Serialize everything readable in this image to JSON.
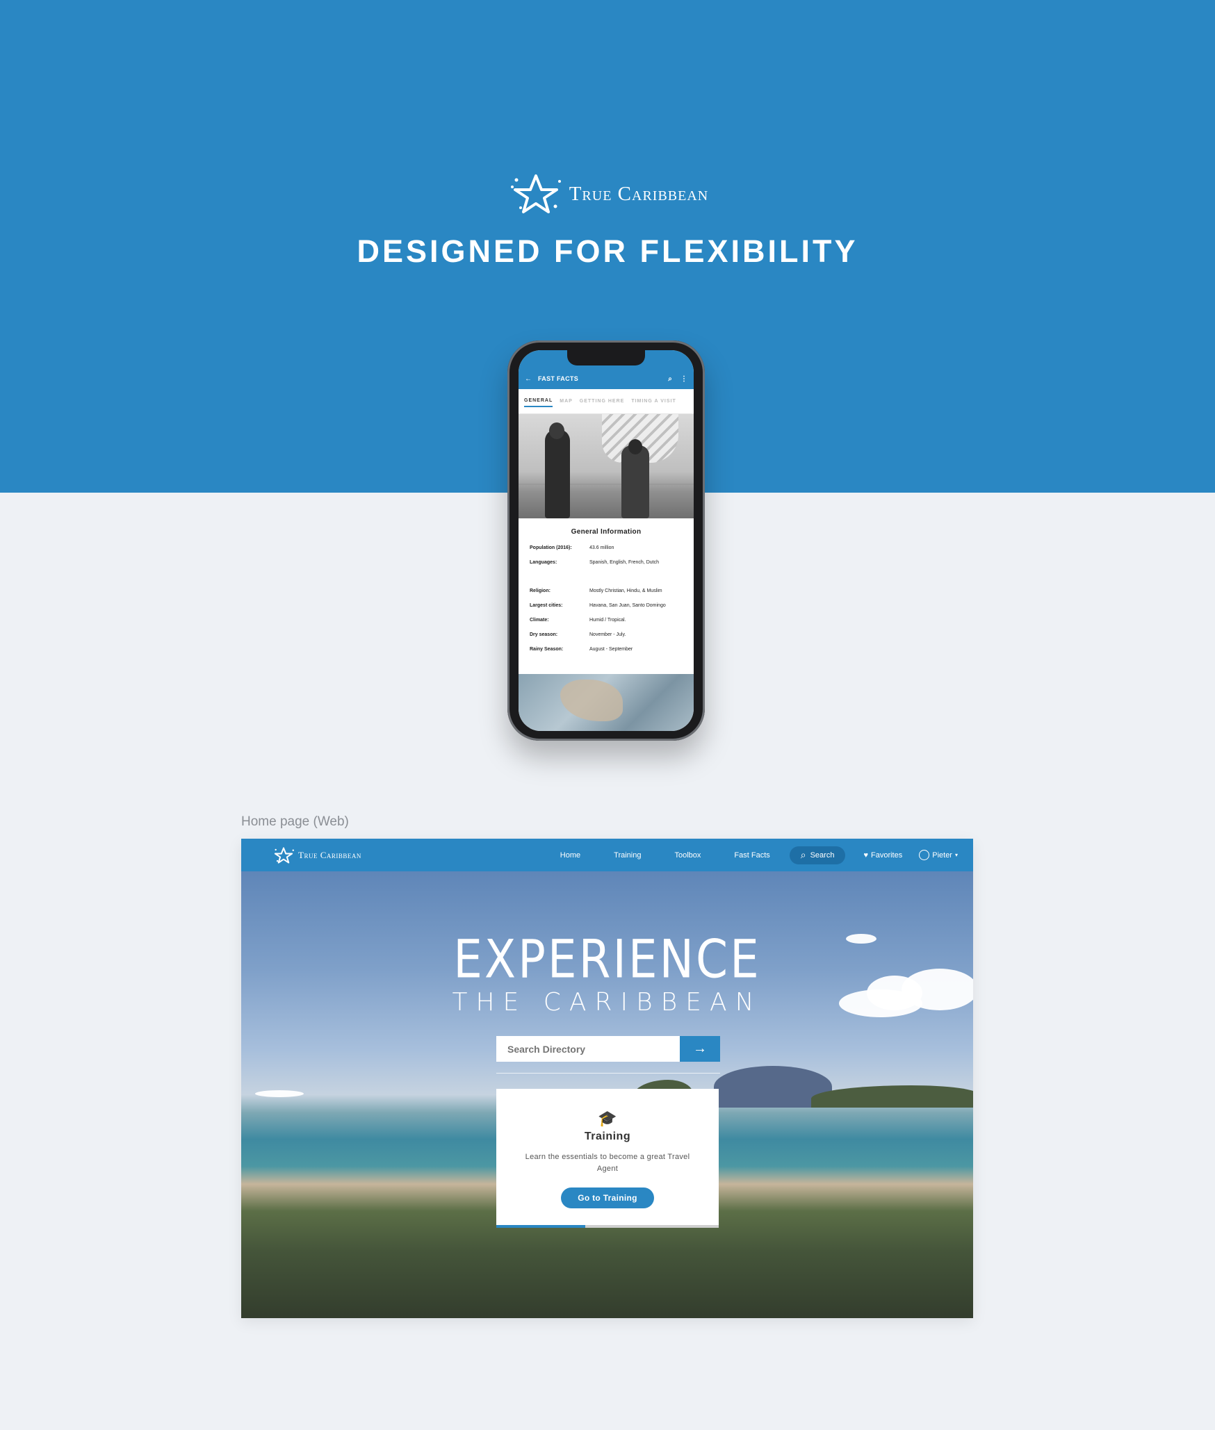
{
  "brand": {
    "name": "True Caribbean"
  },
  "headline": "DESIGNED FOR FLEXIBILITY",
  "phone": {
    "appbar_title": "FAST FACTS",
    "tabs": [
      "GENERAL",
      "MAP",
      "GETTING HERE",
      "TIMING A VISIT"
    ],
    "active_tab": "GENERAL",
    "section_title": "General Information",
    "facts": [
      {
        "key": "Population (2016):",
        "value": "43.6 million"
      },
      {
        "key": "Languages:",
        "value": "Spanish, English, French, Dutch"
      },
      {
        "key": "Religion:",
        "value": "Mostly Christian, Hindu, & Muslim"
      },
      {
        "key": "Largest cities:",
        "value": "Havana, San Juan, Santo Domingo"
      },
      {
        "key": "Climate:",
        "value": "Humid / Tropical."
      },
      {
        "key": "Dry season:",
        "value": "November - July."
      },
      {
        "key": "Rainy Season:",
        "value": "August - September"
      }
    ]
  },
  "web": {
    "caption": "Home page (Web)",
    "brand": "True Caribbean",
    "nav": {
      "home": "Home",
      "training": "Training",
      "toolbox": "Toolbox",
      "fast_facts": "Fast Facts",
      "search": "Search",
      "favorites": "Favorites",
      "user": "Pieter"
    },
    "hero_title": "EXPERIENCE",
    "hero_subtitle": "THE CARIBBEAN",
    "search_placeholder": "Search Directory",
    "card": {
      "title": "Training",
      "description": "Learn the essentials to become a great Travel Agent",
      "button": "Go to Training",
      "progress": 0.4
    },
    "colors": {
      "primary": "#2a87c3",
      "background": "#eef1f5"
    }
  }
}
